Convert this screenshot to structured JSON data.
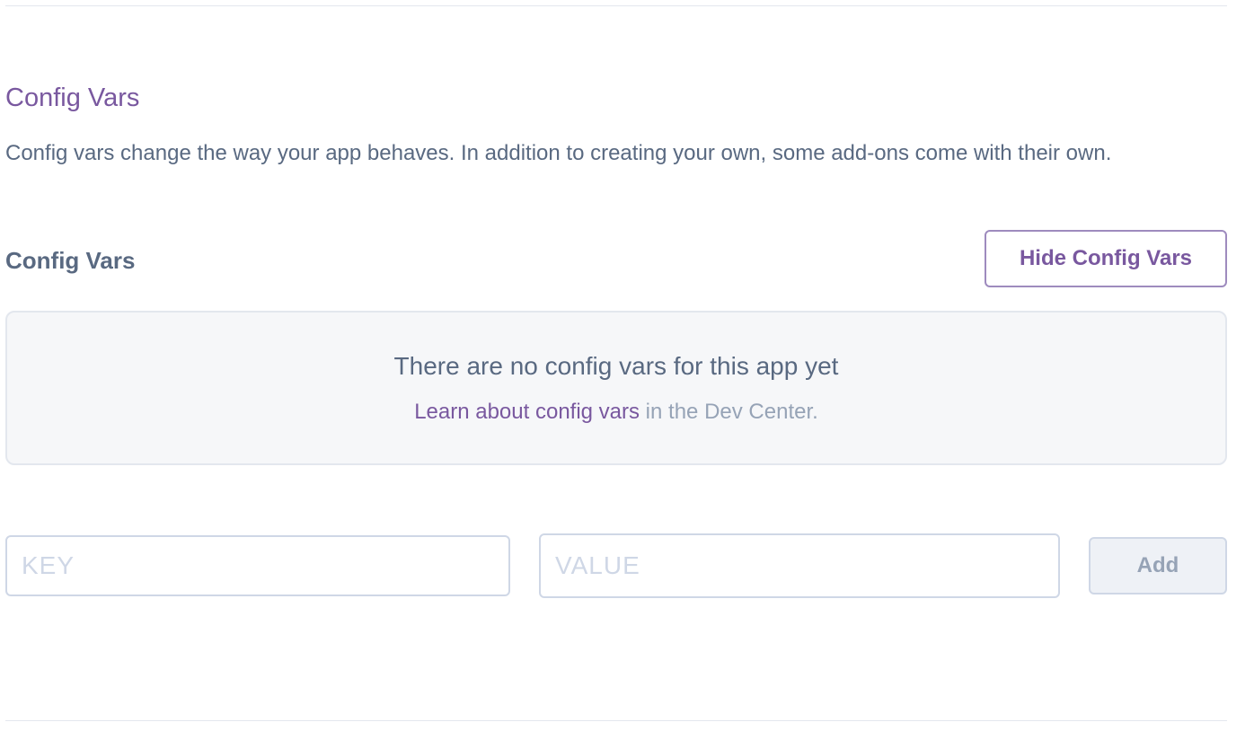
{
  "section": {
    "title": "Config Vars",
    "description": "Config vars change the way your app behaves. In addition to creating your own, some add-ons come with their own."
  },
  "config_vars": {
    "subtitle": "Config Vars",
    "hide_button_label": "Hide Config Vars",
    "empty_state": {
      "title": "There are no config vars for this app yet",
      "link_text": "Learn about config vars",
      "suffix_text": " in the Dev Center."
    },
    "form": {
      "key_placeholder": "KEY",
      "value_placeholder": "VALUE",
      "add_button_label": "Add"
    }
  },
  "colors": {
    "accent": "#79589f",
    "text": "#596981",
    "muted": "#96a3b6",
    "border": "#cfd7e6",
    "panel_bg": "#f6f7f9"
  }
}
